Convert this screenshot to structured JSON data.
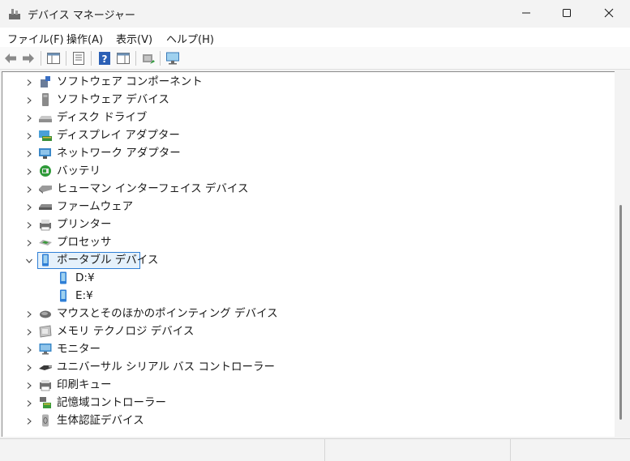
{
  "window": {
    "title": "デバイス マネージャー"
  },
  "menu": [
    "ファイル(F)",
    "操作(A)",
    "表示(V)",
    "ヘルプ(H)"
  ],
  "toolbar_icons": [
    "back-arrow-icon",
    "forward-arrow-icon",
    "console-tree-icon",
    "properties-icon",
    "help-icon",
    "action-pane-icon",
    "update-driver-icon",
    "scan-hardware-icon"
  ],
  "tree": {
    "items": [
      {
        "label": "ソフトウェア コンポーネント",
        "icon": "software-component-icon",
        "expanded": false
      },
      {
        "label": "ソフトウェア デバイス",
        "icon": "software-device-icon",
        "expanded": false
      },
      {
        "label": "ディスク ドライブ",
        "icon": "disk-drive-icon",
        "expanded": false
      },
      {
        "label": "ディスプレイ アダプター",
        "icon": "display-adapter-icon",
        "expanded": false
      },
      {
        "label": "ネットワーク アダプター",
        "icon": "network-adapter-icon",
        "expanded": false
      },
      {
        "label": "バッテリ",
        "icon": "battery-icon",
        "expanded": false
      },
      {
        "label": "ヒューマン インターフェイス デバイス",
        "icon": "hid-icon",
        "expanded": false
      },
      {
        "label": "ファームウェア",
        "icon": "firmware-icon",
        "expanded": false
      },
      {
        "label": "プリンター",
        "icon": "printer-icon",
        "expanded": false
      },
      {
        "label": "プロセッサ",
        "icon": "processor-icon",
        "expanded": false
      },
      {
        "label": "ポータブル デバイス",
        "icon": "portable-device-icon",
        "expanded": true,
        "selected": true,
        "children": [
          {
            "label": "D:¥",
            "icon": "portable-device-icon"
          },
          {
            "label": "E:¥",
            "icon": "portable-device-icon"
          }
        ]
      },
      {
        "label": "マウスとそのほかのポインティング デバイス",
        "icon": "mouse-icon",
        "expanded": false
      },
      {
        "label": "メモリ テクノロジ デバイス",
        "icon": "memory-device-icon",
        "expanded": false
      },
      {
        "label": "モニター",
        "icon": "monitor-icon",
        "expanded": false
      },
      {
        "label": "ユニバーサル シリアル バス コントローラー",
        "icon": "usb-icon",
        "expanded": false
      },
      {
        "label": "印刷キュー",
        "icon": "print-queue-icon",
        "expanded": false
      },
      {
        "label": "記憶域コントローラー",
        "icon": "storage-controller-icon",
        "expanded": false
      },
      {
        "label": "生体認証デバイス",
        "icon": "biometric-icon",
        "expanded": false
      }
    ]
  },
  "colors": {
    "selection_border": "#2f7fd6",
    "selection_fill": "#e5f1fb"
  }
}
